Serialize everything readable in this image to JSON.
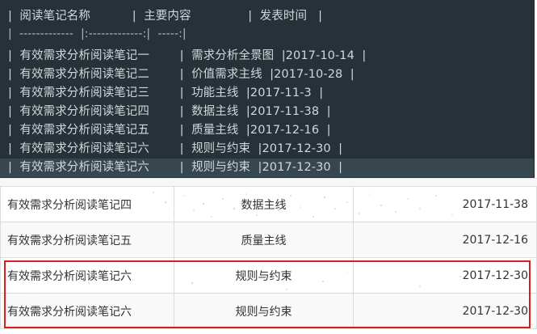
{
  "editor": {
    "header_line": "|  阅读笔记名称           |  主要内容               |  发表时间   |",
    "separator_line": "|  -------------  |:-------------:|  -----:|",
    "rows": [
      "|  有效需求分析阅读笔记一        |  需求分析全景图  |2017-10-14  |",
      "|  有效需求分析阅读笔记二        |  价值需求主线  |2017-10-28  |",
      "|  有效需求分析阅读笔记三        |  功能主线  |2017-11-3  |",
      "|  有效需求分析阅读笔记四        |  数据主线  |2017-11-38  |",
      "|  有效需求分析阅读笔记五        |  质量主线  |2017-12-16  |",
      "|  有效需求分析阅读笔记六        |  规则与约束  |2017-12-30  |",
      "|  有效需求分析阅读笔记六        |  规则与约束  |2017-12-30  |"
    ]
  },
  "preview": {
    "rows": [
      {
        "name": "有效需求分析阅读笔记四",
        "content": "数据主线",
        "date": "2017-11-38"
      },
      {
        "name": "有效需求分析阅读笔记五",
        "content": "质量主线",
        "date": "2017-12-16"
      },
      {
        "name": "有效需求分析阅读笔记六",
        "content": "规则与约束",
        "date": "2017-12-30"
      },
      {
        "name": "有效需求分析阅读笔记六",
        "content": "规则与约束",
        "date": "2017-12-30"
      }
    ]
  },
  "colors": {
    "editor_bg": "#263238",
    "highlight": "#d81e1e"
  }
}
